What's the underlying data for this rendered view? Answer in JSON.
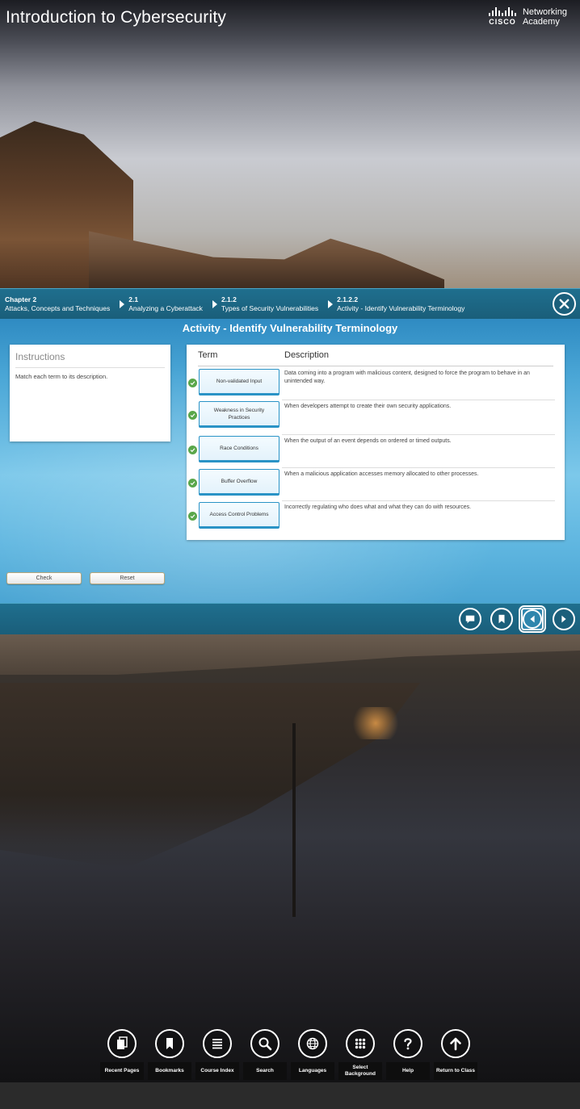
{
  "header": {
    "title": "Introduction to Cybersecurity",
    "logo_word": "CISCO",
    "logo_line1": "Networking",
    "logo_line2": "Academy"
  },
  "breadcrumb": [
    {
      "num": "Chapter 2",
      "label": "Attacks, Concepts and Techniques"
    },
    {
      "num": "2.1",
      "label": "Analyzing a Cyberattack"
    },
    {
      "num": "2.1.2",
      "label": "Types of Security Vulnerabilities"
    },
    {
      "num": "2.1.2.2",
      "label": "Activity - Identify Vulnerability Terminology"
    }
  ],
  "activity": {
    "title": "Activity - Identify Vulnerability Terminology",
    "instructions_heading": "Instructions",
    "instructions_text": "Match each term to its description.",
    "col_term": "Term",
    "col_description": "Description",
    "rows": [
      {
        "term": "Non-validated Input",
        "description": "Data coming into a program with malicious content, designed to force the program to behave in an unintended way."
      },
      {
        "term": "Weakness in Security Practices",
        "description": "When developers attempt to create their own security applications."
      },
      {
        "term": "Race Conditions",
        "description": "When the output of an event depends on ordered or timed outputs."
      },
      {
        "term": "Buffer Overflow",
        "description": "When a malicious application accesses memory allocated to other processes."
      },
      {
        "term": "Access Control Problems",
        "description": "Incorrectly regulating who does what and what they can do with resources."
      }
    ],
    "check_label": "Check",
    "reset_label": "Reset"
  },
  "toolbar": [
    {
      "icon": "recent-pages-icon",
      "label": "Recent Pages"
    },
    {
      "icon": "bookmarks-icon",
      "label": "Bookmarks"
    },
    {
      "icon": "course-index-icon",
      "label": "Course Index"
    },
    {
      "icon": "search-icon",
      "label": "Search"
    },
    {
      "icon": "languages-icon",
      "label": "Languages"
    },
    {
      "icon": "select-background-icon",
      "label": "Select Background"
    },
    {
      "icon": "help-icon",
      "label": "Help"
    },
    {
      "icon": "return-to-class-icon",
      "label": "Return to Class"
    }
  ],
  "colors": {
    "panel_bar": "#1f6f8e",
    "check_green": "#5aa74a",
    "term_border": "#2a93c6"
  }
}
